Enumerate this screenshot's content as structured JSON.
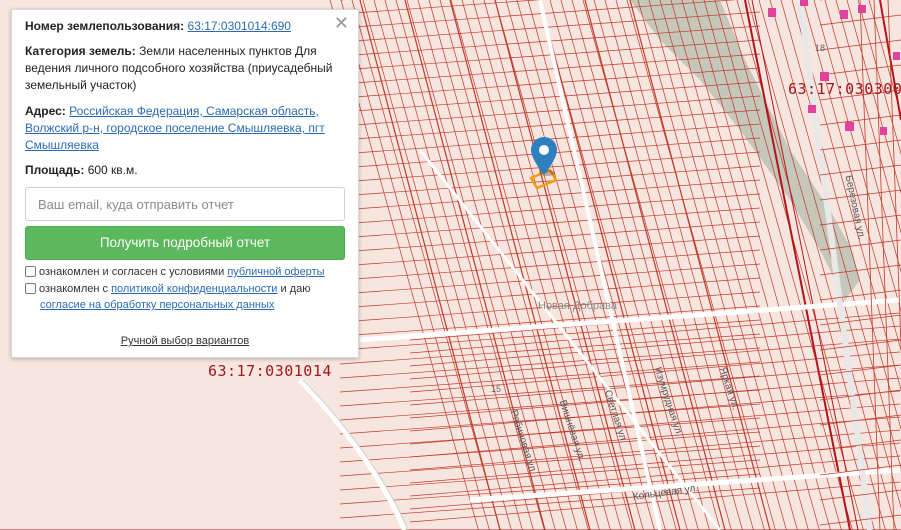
{
  "popup": {
    "cadastral_label": "Номер землепользования:",
    "cadastral_value": "63:17:0301014:690",
    "category_label": "Категория земель:",
    "category_value": "Земли населенных пунктов Для ведения личного подсобного хозяйства (приусадебный земельный участок)",
    "address_label": "Адрес:",
    "address_value": "Российская Федерация, Самарская область, Волжский р-н, городское поселение Смышляевка, пгт Смышляевка",
    "area_label": "Площадь:",
    "area_value": "600 кв.м.",
    "email_placeholder": "Ваш email, куда отправить отчет",
    "report_button": "Получить подробный отчет",
    "offer_text": "ознакомлен и согласен с условиями",
    "offer_link": "публичной оферты",
    "privacy_text": "ознакомлен с",
    "privacy_link": "политикой конфиденциальности",
    "privacy_text2": "и даю",
    "consent_link": "согласие на обработку персональных данных",
    "manual_link": "Ручной выбор вариантов",
    "close_icon": "close-icon"
  },
  "map": {
    "quarter_label_main": "63:17:0301014",
    "quarter_label_top": "63:17:030300",
    "place_name": "Новая Добрава",
    "streets": {
      "beryozovaya": "Березовая ул.",
      "ryabinovaya": "Рябиновая ул.",
      "vishnyovaya": "Вишнёвая ул.",
      "svetlaya": "Светлая ул.",
      "izumrudnaya": "Изумрудная ул.",
      "yarkaya": "Яркая ул.",
      "koltsevaya": "Кольцевая ул."
    },
    "house_numbers": [
      "18",
      "15"
    ],
    "marker_icon": "map-pin-icon",
    "colors": {
      "parcel_line": "#c0392b",
      "quarter_line": "#b3131a",
      "parcel_highlight": "#f39c12",
      "marker": "#2d7fc0",
      "road": "#ffffff"
    }
  }
}
